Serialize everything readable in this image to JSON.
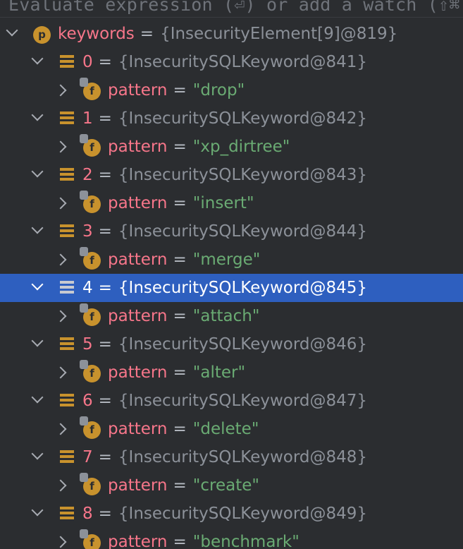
{
  "eval_bar": {
    "placeholder": "Evaluate expression (⏎) or add a watch (⇧⌘"
  },
  "root": {
    "name": "keywords",
    "value": "{InsecurityElement[9]@819}",
    "badge": "p"
  },
  "items": [
    {
      "index": "0",
      "value": "{InsecuritySQLKeyword@841}",
      "field": "pattern",
      "field_value": "\"drop\""
    },
    {
      "index": "1",
      "value": "{InsecuritySQLKeyword@842}",
      "field": "pattern",
      "field_value": "\"xp_dirtree\""
    },
    {
      "index": "2",
      "value": "{InsecuritySQLKeyword@843}",
      "field": "pattern",
      "field_value": "\"insert\""
    },
    {
      "index": "3",
      "value": "{InsecuritySQLKeyword@844}",
      "field": "pattern",
      "field_value": "\"merge\""
    },
    {
      "index": "4",
      "value": "{InsecuritySQLKeyword@845}",
      "field": "pattern",
      "field_value": "\"attach\"",
      "selected": true
    },
    {
      "index": "5",
      "value": "{InsecuritySQLKeyword@846}",
      "field": "pattern",
      "field_value": "\"alter\""
    },
    {
      "index": "6",
      "value": "{InsecuritySQLKeyword@847}",
      "field": "pattern",
      "field_value": "\"delete\""
    },
    {
      "index": "7",
      "value": "{InsecuritySQLKeyword@848}",
      "field": "pattern",
      "field_value": "\"create\""
    },
    {
      "index": "8",
      "value": "{InsecuritySQLKeyword@849}",
      "field": "pattern",
      "field_value": "\"benchmark\""
    }
  ],
  "field_badge": "f",
  "eq": "=",
  "colors": {
    "background": "#2b2d30",
    "selection": "#2e5fbf",
    "name": "#f7768a",
    "string": "#6aab73",
    "type": "#8c9199",
    "badge": "#c8922d"
  },
  "icons": {
    "expand": "chevron-down-icon",
    "collapse": "chevron-right-icon",
    "array_element": "array-element-icon",
    "field": "field-icon",
    "parameter": "parameter-icon"
  }
}
